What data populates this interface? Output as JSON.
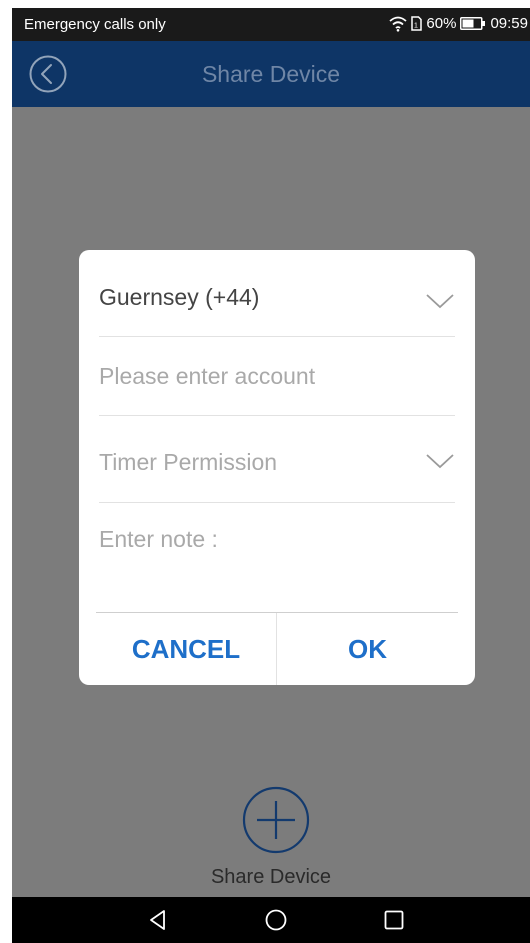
{
  "status_bar": {
    "carrier_text": "Emergency calls only",
    "battery_percent": "60%",
    "time": "09:59"
  },
  "header": {
    "title": "Share Device",
    "back_icon": "back-circle-icon"
  },
  "dialog": {
    "country": {
      "value": "Guernsey (+44)",
      "icon": "chevron-down-icon"
    },
    "account": {
      "placeholder": "Please enter account",
      "value": ""
    },
    "permission": {
      "value": "Timer Permission",
      "icon": "chevron-down-icon"
    },
    "note": {
      "placeholder": "Enter note :",
      "value": ""
    },
    "cancel_label": "CANCEL",
    "ok_label": "OK"
  },
  "share": {
    "label": "Share Device",
    "icon": "plus-circle-icon"
  },
  "nav": {
    "back_icon": "nav-back-icon",
    "home_icon": "nav-home-icon",
    "recents_icon": "nav-recents-icon"
  },
  "colors": {
    "header_bg": "#0e3566",
    "overlay_bg": "#7c7c7c",
    "accent": "#1e6fc9",
    "share_icon": "#133a6e"
  }
}
